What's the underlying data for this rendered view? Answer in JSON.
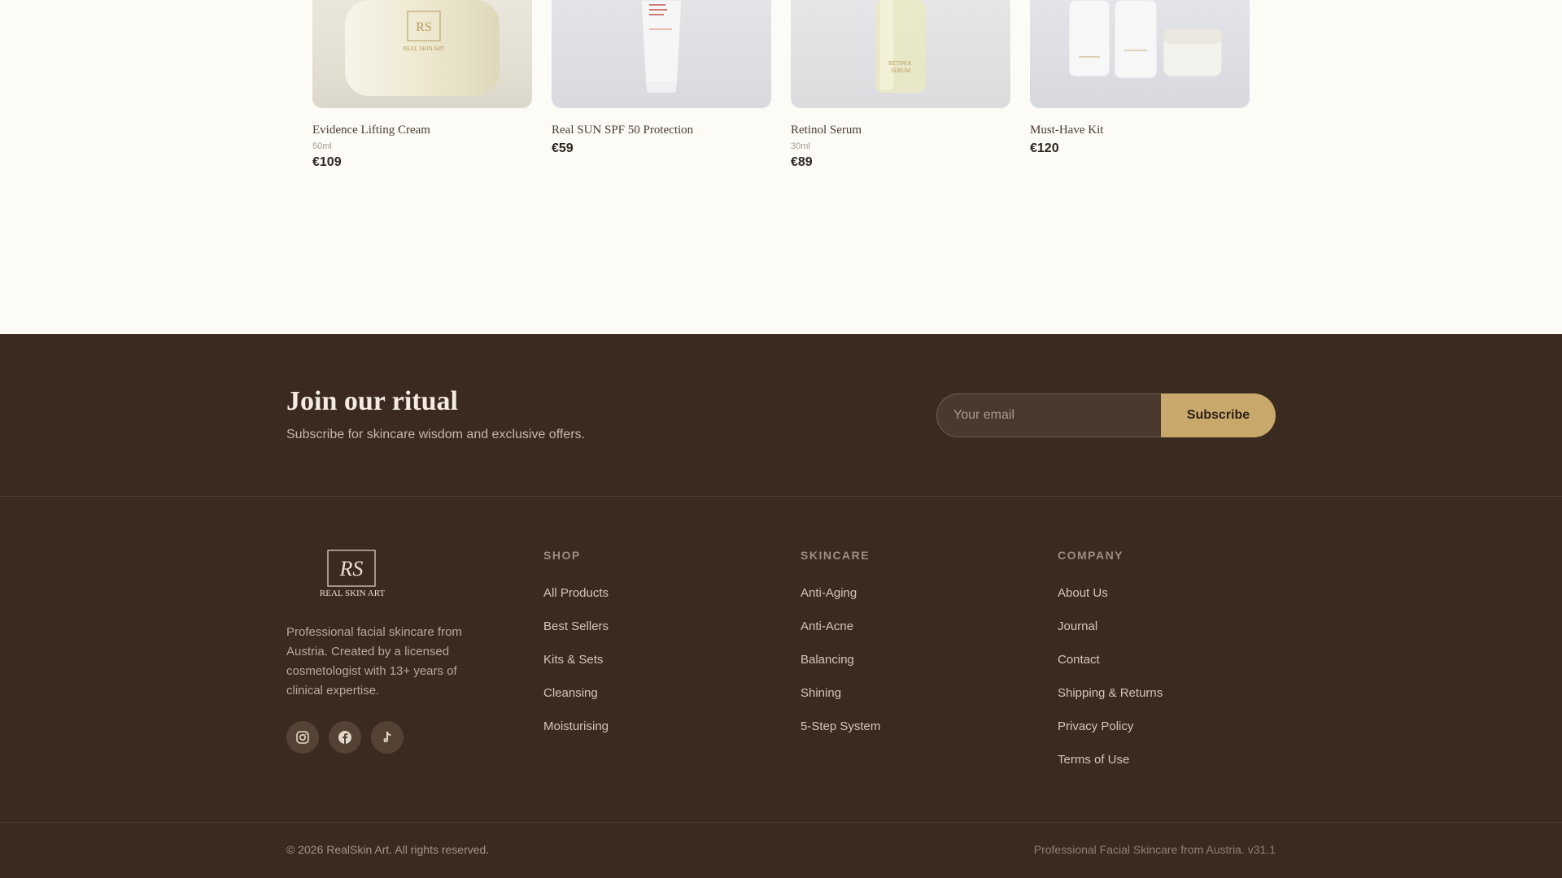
{
  "products": [
    {
      "name": "Evidence Lifting Cream",
      "size": "50ml",
      "price": "€109"
    },
    {
      "name": "Real SUN SPF 50 Protection",
      "size": "",
      "price": "€59"
    },
    {
      "name": "Retinol Serum",
      "size": "30ml",
      "price": "€89"
    },
    {
      "name": "Must-Have Kit",
      "size": "",
      "price": "€120"
    }
  ],
  "newsletter": {
    "title": "Join our ritual",
    "subtitle": "Subscribe for skincare wisdom and exclusive offers.",
    "email_placeholder": "Your email",
    "button": "Subscribe"
  },
  "brand": {
    "logo_text": "REAL SKIN ART",
    "monogram": "RS",
    "about": "Professional facial skincare from Austria. Created by a licensed cosmetologist with 13+ years of clinical expertise.",
    "socials": [
      "instagram-icon",
      "facebook-icon",
      "tiktok-icon"
    ]
  },
  "columns": {
    "shop": {
      "title": "SHOP",
      "links": [
        "All Products",
        "Best Sellers",
        "Kits & Sets",
        "Cleansing",
        "Moisturising"
      ]
    },
    "skincare": {
      "title": "SKINCARE",
      "links": [
        "Anti-Aging",
        "Anti-Acne",
        "Balancing",
        "Shining",
        "5-Step System"
      ]
    },
    "company": {
      "title": "COMPANY",
      "links": [
        "About Us",
        "Journal",
        "Contact",
        "Shipping & Returns",
        "Privacy Policy",
        "Terms of Use"
      ]
    }
  },
  "bottom": {
    "copyright": "© 2026 RealSkin Art. All rights reserved.",
    "tagline": "Professional Facial Skincare from Austria. v31.1"
  },
  "colors": {
    "footer_bg": "#3b2a1f",
    "accent": "#c9a86b",
    "page_bg": "#fdfbf6"
  }
}
